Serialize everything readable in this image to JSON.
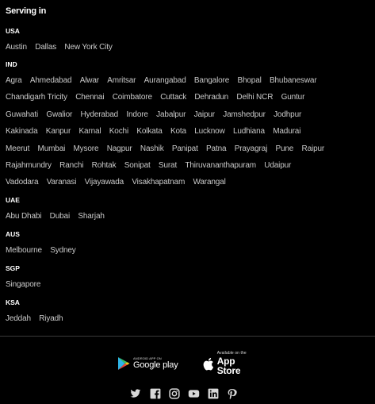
{
  "serving": {
    "title": "Serving in",
    "countries": [
      {
        "code": "USA",
        "rows": [
          [
            "Austin",
            "Dallas",
            "New York City"
          ]
        ]
      },
      {
        "code": "IND",
        "rows": [
          [
            "Agra",
            "Ahmedabad",
            "Alwar",
            "Amritsar",
            "Aurangabad",
            "Bangalore",
            "Bhopal",
            "Bhubaneswar"
          ],
          [
            "Chandigarh Tricity",
            "Chennai",
            "Coimbatore",
            "Cuttack",
            "Dehradun",
            "Delhi NCR",
            "Guntur"
          ],
          [
            "Guwahati",
            "Gwalior",
            "Hyderabad",
            "Indore",
            "Jabalpur",
            "Jaipur",
            "Jamshedpur",
            "Jodhpur"
          ],
          [
            "Kakinada",
            "Kanpur",
            "Karnal",
            "Kochi",
            "Kolkata",
            "Kota",
            "Lucknow",
            "Ludhiana",
            "Madurai"
          ],
          [
            "Meerut",
            "Mumbai",
            "Mysore",
            "Nagpur",
            "Nashik",
            "Panipat",
            "Patna",
            "Prayagraj",
            "Pune",
            "Raipur"
          ],
          [
            "Rajahmundry",
            "Ranchi",
            "Rohtak",
            "Sonipat",
            "Surat",
            "Thiruvananthapuram",
            "Udaipur"
          ],
          [
            "Vadodara",
            "Varanasi",
            "Vijayawada",
            "Visakhapatnam",
            "Warangal"
          ]
        ]
      },
      {
        "code": "UAE",
        "rows": [
          [
            "Abu Dhabi",
            "Dubai",
            "Sharjah"
          ]
        ]
      },
      {
        "code": "AUS",
        "rows": [
          [
            "Melbourne",
            "Sydney"
          ]
        ]
      },
      {
        "code": "SGP",
        "rows": [
          [
            "Singapore"
          ]
        ]
      },
      {
        "code": "KSA",
        "rows": [
          [
            "Jeddah",
            "Riyadh"
          ]
        ]
      }
    ]
  },
  "footer": {
    "google_play": {
      "small": "ANDROID APP ON",
      "big": "Google play",
      "icon": "google-play-icon"
    },
    "app_store": {
      "small": "Available on the",
      "big": "App Store",
      "icon": "apple-icon"
    },
    "socials": [
      {
        "name": "twitter",
        "icon": "twitter-icon"
      },
      {
        "name": "facebook",
        "icon": "facebook-icon"
      },
      {
        "name": "instagram",
        "icon": "instagram-icon"
      },
      {
        "name": "youtube",
        "icon": "youtube-icon"
      },
      {
        "name": "linkedin",
        "icon": "linkedin-icon"
      },
      {
        "name": "pinterest",
        "icon": "pinterest-icon"
      }
    ]
  },
  "colors": {
    "background": "#000000",
    "heading": "#ffffff",
    "city_text": "#c9c9c9",
    "divider": "#3a3a3a"
  }
}
